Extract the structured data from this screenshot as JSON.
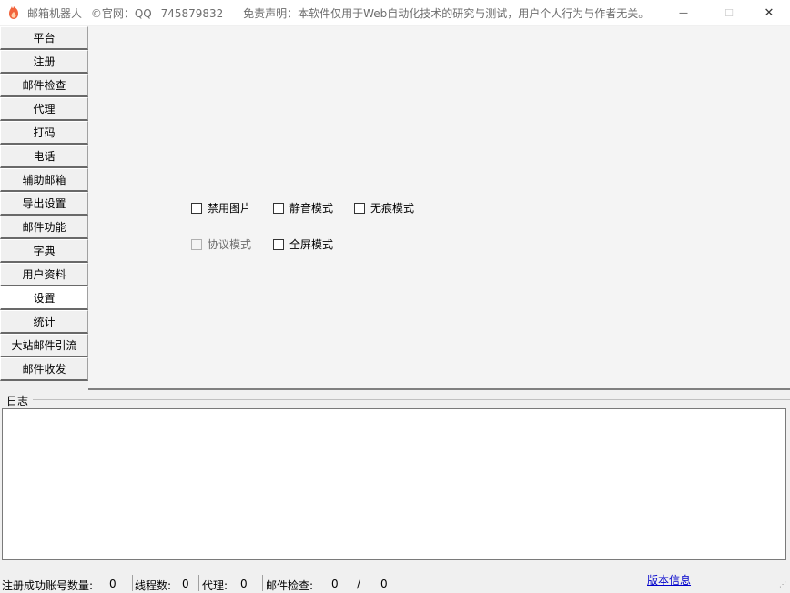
{
  "window": {
    "title_app": "邮箱机器人",
    "title_copyright": "©官网：QQ",
    "title_qq": "745879832",
    "title_disclaimer": "免责声明：本软件仅用于Web自动化技术的研究与测试，用户个人行为与作者无关。",
    "minimize_glyph": "—",
    "maximize_glyph": "☐",
    "close_glyph": "✕",
    "icon": "flame-shield-icon"
  },
  "sidebar": {
    "items": [
      {
        "label": "平台"
      },
      {
        "label": "注册"
      },
      {
        "label": "邮件检查"
      },
      {
        "label": "代理"
      },
      {
        "label": "打码"
      },
      {
        "label": "电话"
      },
      {
        "label": "辅助邮箱"
      },
      {
        "label": "导出设置"
      },
      {
        "label": "邮件功能"
      },
      {
        "label": "字典"
      },
      {
        "label": "用户资料"
      },
      {
        "label": "设置"
      },
      {
        "label": "统计"
      },
      {
        "label": "大站邮件引流"
      },
      {
        "label": "邮件收发"
      }
    ],
    "active_index": 11
  },
  "settings": {
    "checkboxes": [
      {
        "label": "禁用图片",
        "checked": false,
        "enabled": true
      },
      {
        "label": "静音模式",
        "checked": false,
        "enabled": true
      },
      {
        "label": "无痕模式",
        "checked": false,
        "enabled": true
      },
      {
        "label": "协议模式",
        "checked": false,
        "enabled": false
      },
      {
        "label": "全屏模式",
        "checked": false,
        "enabled": true
      }
    ]
  },
  "log": {
    "label": "日志",
    "content": ""
  },
  "status": {
    "registered_label": "注册成功账号数量:",
    "registered_value": "0",
    "threads_label": "线程数:",
    "threads_value": "0",
    "proxy_label": "代理:",
    "proxy_value": "0",
    "mail_check_label": "邮件检查:",
    "mail_check_value": "0",
    "mail_check_slash": "/",
    "mail_check_total": "0",
    "version_link": "版本信息"
  },
  "colors": {
    "titlebar_bg": "#ffffff",
    "panel_bg": "#f4f4f4",
    "window_bg": "#f0f0f0",
    "link": "#0000cc",
    "icon_accent": "#f2643c"
  }
}
